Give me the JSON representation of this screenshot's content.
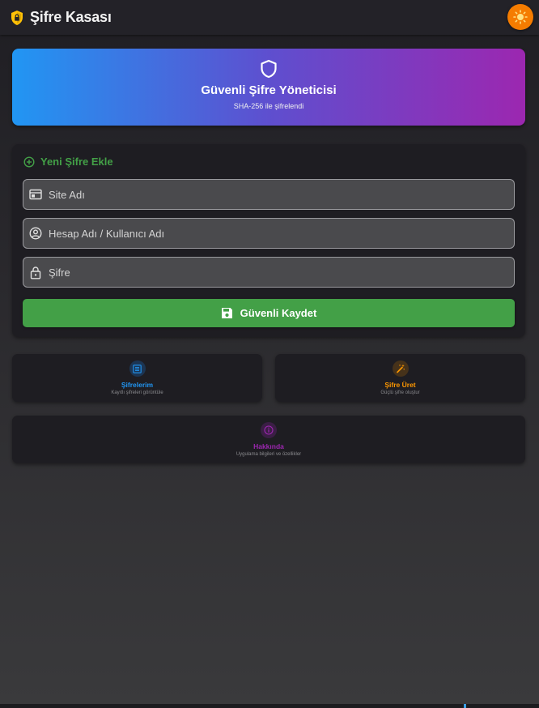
{
  "appbar": {
    "title": "Şifre Kasası",
    "logo_icon": "shield-lock-icon",
    "theme_icon": "sun-icon",
    "theme_color": "#f57c00"
  },
  "hero": {
    "icon": "shield-icon",
    "title": "Güvenli Şifre Yöneticisi",
    "subtitle": "SHA-256 ile şifrelendi",
    "gradient": [
      "#2196f3",
      "#9c27b0"
    ]
  },
  "form": {
    "heading": "Yeni Şifre Ekle",
    "heading_color": "#43a047",
    "site": {
      "placeholder": "Site Adı",
      "value": "",
      "icon": "web-icon"
    },
    "account": {
      "placeholder": "Hesap Adı / Kullanıcı Adı",
      "value": "",
      "icon": "account-circle-icon"
    },
    "password": {
      "placeholder": "Şifre",
      "value": "",
      "icon": "lock-icon"
    },
    "save_label": "Güvenli Kaydet",
    "save_icon": "save-icon",
    "save_color": "#43a047"
  },
  "tiles": [
    {
      "title": "Şifrelerim",
      "subtitle": "Kayıtlı şifreleri görüntüle",
      "icon": "list-icon",
      "color": "#2196f3"
    },
    {
      "title": "Şifre Üret",
      "subtitle": "Güçlü şifre oluştur",
      "icon": "magic-wand-icon",
      "color": "#ff9800"
    },
    {
      "title": "Hakkında",
      "subtitle": "Uygulama bilgileri ve özellikler",
      "icon": "info-icon",
      "color": "#9c27b0"
    }
  ]
}
